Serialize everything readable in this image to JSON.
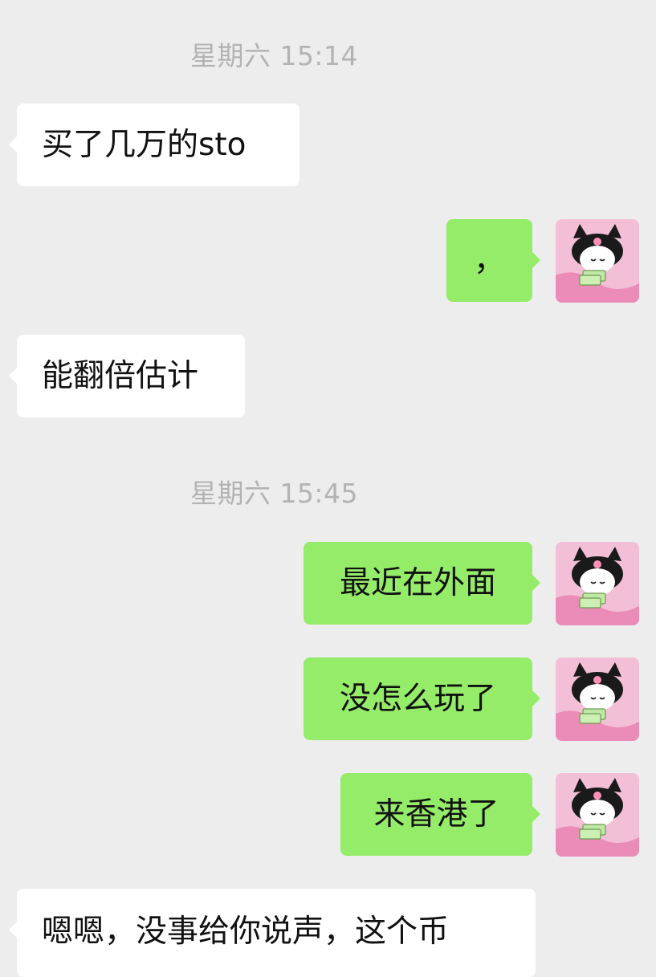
{
  "chat": {
    "messages": [
      {
        "type": "timestamp",
        "text": "星期六 15:14"
      },
      {
        "type": "incoming",
        "text": "买了几万的sto"
      },
      {
        "type": "outgoing",
        "text": "，",
        "avatar": "kuromi-avatar"
      },
      {
        "type": "incoming",
        "text": "能翻倍估计"
      },
      {
        "type": "timestamp",
        "text": "星期六 15:45"
      },
      {
        "type": "outgoing",
        "text": "最近在外面",
        "avatar": "kuromi-avatar"
      },
      {
        "type": "outgoing",
        "text": "没怎么玩了",
        "avatar": "kuromi-avatar"
      },
      {
        "type": "outgoing",
        "text": "来香港了",
        "avatar": "kuromi-avatar"
      },
      {
        "type": "incoming",
        "text": "嗯嗯，没事给你说声，这个币"
      }
    ]
  },
  "colors": {
    "background": "#ededed",
    "incoming_bubble": "#ffffff",
    "outgoing_bubble": "#95ec69",
    "timestamp_text": "#b3b3b3"
  }
}
